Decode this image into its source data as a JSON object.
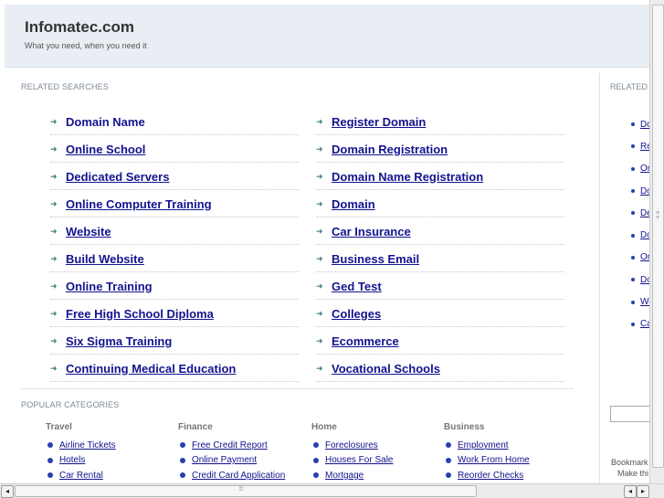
{
  "header": {
    "title": "Infomatec.com",
    "tagline": "What you need, when you need it"
  },
  "related_searches": {
    "heading": "RELATED SEARCHES",
    "left": [
      {
        "label": "Domain Name",
        "underline": false
      },
      {
        "label": "Online School",
        "underline": true
      },
      {
        "label": "Dedicated Servers",
        "underline": true
      },
      {
        "label": "Online Computer Training",
        "underline": true
      },
      {
        "label": "Website",
        "underline": true
      },
      {
        "label": "Build Website",
        "underline": true
      },
      {
        "label": "Online Training",
        "underline": true
      },
      {
        "label": "Free High School Diploma",
        "underline": true
      },
      {
        "label": "Six Sigma Training",
        "underline": true
      },
      {
        "label": "Continuing Medical Education",
        "underline": true
      }
    ],
    "right": [
      {
        "label": "Register Domain",
        "underline": true
      },
      {
        "label": "Domain Registration",
        "underline": true
      },
      {
        "label": "Domain Name Registration",
        "underline": true
      },
      {
        "label": "Domain",
        "underline": true
      },
      {
        "label": "Car Insurance",
        "underline": true
      },
      {
        "label": "Business Email",
        "underline": true
      },
      {
        "label": "Ged Test",
        "underline": true
      },
      {
        "label": "Colleges",
        "underline": true
      },
      {
        "label": "Ecommerce",
        "underline": true
      },
      {
        "label": "Vocational Schools",
        "underline": true
      }
    ]
  },
  "popular_categories": {
    "heading": "POPULAR CATEGORIES",
    "columns": [
      {
        "title": "Travel",
        "items": [
          "Airline Tickets",
          "Hotels",
          "Car Rental"
        ]
      },
      {
        "title": "Finance",
        "items": [
          "Free Credit Report",
          "Online Payment",
          "Credit Card Application"
        ]
      },
      {
        "title": "Home",
        "items": [
          "Foreclosures",
          "Houses For Sale",
          "Mortgage"
        ]
      },
      {
        "title": "Business",
        "items": [
          "Employment",
          "Work From Home",
          "Reorder Checks"
        ]
      }
    ]
  },
  "sidebar": {
    "heading": "RELATED",
    "items": [
      "Do",
      "Re",
      "On",
      "Do",
      "De",
      "Do",
      "On",
      "Do",
      "We",
      "Ca"
    ],
    "bookmark_line1": "Bookmark",
    "bookmark_line2": "Make thi"
  },
  "scrollbar": {
    "left_arrow": "◂",
    "right_arrow": "▸",
    "grip": "⁞⁞⁞⁞⁞"
  },
  "colors": {
    "link": "#13138f",
    "header_bg": "#e8eef3",
    "arrow": "#3a7d80"
  },
  "icons": {
    "link_arrow": "arrow-right-icon",
    "bullet": "bullet-icon"
  }
}
